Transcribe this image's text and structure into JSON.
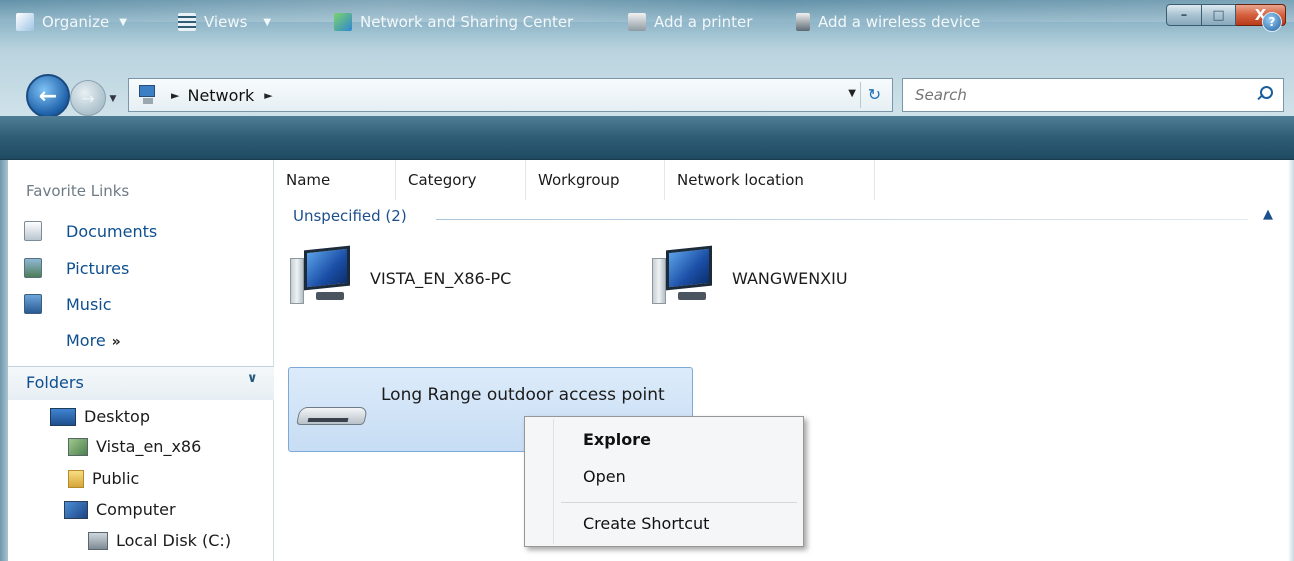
{
  "window": {
    "buttons": {
      "minimize": "–",
      "maximize": "□",
      "close": "X"
    }
  },
  "address": {
    "icon": "network-icon",
    "separator": "►",
    "location": "Network",
    "trailing_separator": "►",
    "dropdown": "▼",
    "refresh": "↻"
  },
  "nav": {
    "back": "←",
    "forward": "→",
    "history_dropdown": "▼"
  },
  "search": {
    "placeholder": "Search"
  },
  "toolbar": {
    "organize": "Organize",
    "views": "Views",
    "network_sharing": "Network and Sharing Center",
    "add_printer": "Add a printer",
    "add_wireless": "Add a wireless device",
    "dropdown_arrow": "▼",
    "help": "?"
  },
  "sidebar": {
    "favorite_links_title": "Favorite Links",
    "links": [
      {
        "label": "Documents",
        "icon": "documents-icon"
      },
      {
        "label": "Pictures",
        "icon": "pictures-icon"
      },
      {
        "label": "Music",
        "icon": "music-icon"
      }
    ],
    "more": "More",
    "more_chevron": "»",
    "folders_title": "Folders",
    "folders_chevron": "∨",
    "tree": [
      {
        "label": "Desktop",
        "icon": "desktop-icon"
      },
      {
        "label": "Vista_en_x86",
        "icon": "user-folder-icon"
      },
      {
        "label": "Public",
        "icon": "folder-icon"
      },
      {
        "label": "Computer",
        "icon": "computer-icon"
      },
      {
        "label": "Local Disk (C:)",
        "icon": "local-disk-icon"
      }
    ]
  },
  "columns": [
    "Name",
    "Category",
    "Workgroup",
    "Network location"
  ],
  "group": {
    "label": "Unspecified (2)",
    "chevron": "▲"
  },
  "computers": [
    {
      "label": "VISTA_EN_X86-PC"
    },
    {
      "label": "WANGWENXIU"
    }
  ],
  "access_point": {
    "label": "Long Range outdoor access point"
  },
  "context_menu": {
    "items": [
      "Explore",
      "Open",
      "Create Shortcut"
    ]
  },
  "colors": {
    "toolbar_bg": "#2f5d76",
    "link_blue": "#0e4f8f",
    "selection": "#c7ddf4",
    "close_red": "#d5603e"
  }
}
